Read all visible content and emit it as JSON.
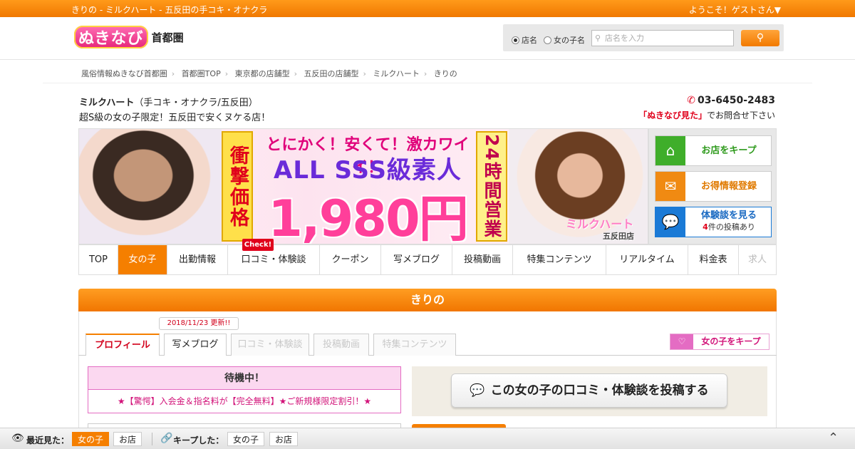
{
  "topbar": {
    "title": "きりの - ミルクハート - 五反田の手コキ・オナクラ",
    "welcome": "ようこそ！ゲストさん▼"
  },
  "header": {
    "logo_text": "ぬきなび",
    "logo_region": "首都圏",
    "search": {
      "radio_shop": "店名",
      "radio_girl": "女の子名",
      "selected": "店名",
      "placeholder": "店名を入力",
      "button_icon": "search-icon"
    }
  },
  "breadcrumb": [
    "風俗情報ぬきなび首都圏",
    "首都圏TOP",
    "東京都の店舗型",
    "五反田の店舗型",
    "ミルクハート",
    "きりの"
  ],
  "shop": {
    "name": "ミルクハート",
    "category": "（手コキ・オナクラ/五反田）",
    "catch": "超S級の女の子限定！五反田で安くヌケる店！",
    "phone": "03-6450-2483",
    "phone_note_emph": "「ぬきなび見た」",
    "phone_note_rest": "でお問合せ下さい"
  },
  "banner": {
    "left_vertical": "衝撃価格",
    "headline": "とにかく！安くて！激カワイイ！",
    "sss": "ALL SSS級素人",
    "price": "1,980円",
    "right_vertical": "24時間営業",
    "logo": "ミルクハート",
    "branch": "五反田店"
  },
  "side_buttons": {
    "keep_shop": "お店をキープ",
    "newsletter": "お得情報登録",
    "reviews": "体験談を見る",
    "review_count": "4",
    "review_count_suffix": "件の投稿あり"
  },
  "nav": {
    "items": [
      "TOP",
      "女の子",
      "出勤情報",
      "口コミ・体験談",
      "クーポン",
      "写メブログ",
      "投稿動画",
      "特集コンテンツ",
      "リアルタイム",
      "料金表",
      "求人"
    ],
    "active": "女の子",
    "disabled": "求人",
    "check_badge": "Check!"
  },
  "girl": {
    "name": "きりの",
    "update_tag": "2018/11/23 更新!!",
    "tabs": [
      "プロフィール",
      "写メブログ",
      "口コミ・体験談",
      "投稿動画",
      "特集コンテンツ"
    ],
    "active_tab": "プロフィール",
    "keep_button": "女の子をキープ",
    "status": "待機中！",
    "promo": "★【驚愕】入会金＆指名料が【完全無料】★ご新規様限定割引！★",
    "post_review": "この女の子の口コミ・体験談を投稿する"
  },
  "footer": {
    "recent_label": "最近見た：",
    "recent_girl": "女の子",
    "recent_shop": "お店",
    "kept_label": "キープした：",
    "kept_girl": "女の子",
    "kept_shop": "お店"
  },
  "colors": {
    "accent_orange": "#f57f00",
    "pink": "#e46cc3",
    "red": "#e0001b"
  }
}
